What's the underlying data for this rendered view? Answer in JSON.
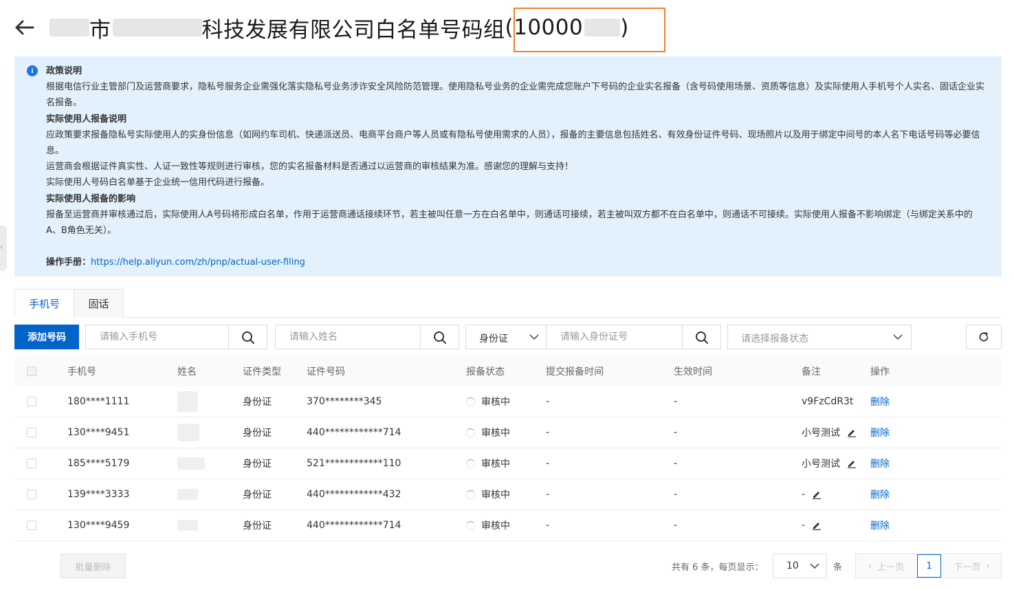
{
  "header": {
    "title_part1": "市",
    "title_part2": "科技发展有限公司白名单号码组",
    "title_paren_open": "(10000",
    "title_paren_close": ")"
  },
  "notice": {
    "heading1": "政策说明",
    "para1": "根据电信行业主管部门及运营商要求，隐私号服务企业需强化落实隐私号业务涉诈安全风险防范管理。使用隐私号业务的企业需完成您账户下号码的企业实名报备（含号码使用场景、资质等信息）及实际使用人手机号个人实名、固话企业实名报备。",
    "heading2": "实际使用人报备说明",
    "para2": "应政策要求报备隐私号实际使用人的实身份信息（如网约车司机、快递派送员、电商平台商户等人员或有隐私号使用需求的人员），报备的主要信息包括姓名、有效身份证件号码、现场照片以及用于绑定中间号的本人名下电话号码等必要信息。",
    "para3": "运营商会根据证件真实性、人证一致性等规则进行审核，您的实名报备材料是否通过以运营商的审核结果为准。感谢您的理解与支持！",
    "para4": "实际使用人号码白名单基于企业统一信用代码进行报备。",
    "heading3": "实际使用人报备的影响",
    "para5": "报备至运营商并审核通过后，实际使用人A号码将形成白名单，作用于运营商通话接续环节，若主被叫任意一方在白名单中，则通话可接续，若主被叫双方都不在白名单中，则通话不可接续。实际使用人报备不影响绑定（与绑定关系中的A、B角色无关）。",
    "manual_label": "操作手册：",
    "manual_link": "https://help.aliyun.com/zh/pnp/actual-user-filing"
  },
  "tabs": {
    "mobile": "手机号",
    "fixed": "固话"
  },
  "toolbar": {
    "add_button": "添加号码",
    "phone_placeholder": "请输入手机号",
    "name_placeholder": "请输入姓名",
    "id_type_value": "身份证",
    "id_placeholder": "请输入身份证号",
    "status_placeholder": "请选择报备状态"
  },
  "table": {
    "headers": {
      "phone": "手机号",
      "name": "姓名",
      "id_type": "证件类型",
      "id_number": "证件号码",
      "status": "报备状态",
      "submit_time": "提交报备时间",
      "effect_time": "生效时间",
      "remark": "备注",
      "action": "操作"
    },
    "rows": [
      {
        "phone": "180****1111",
        "id_type": "身份证",
        "id_number": "370********345",
        "status": "审核中",
        "submit_time": "-",
        "effect_time": "-",
        "remark": "v9FzCdR3t",
        "action": "删除"
      },
      {
        "phone": "130****9451",
        "id_type": "身份证",
        "id_number": "440************714",
        "status": "审核中",
        "submit_time": "-",
        "effect_time": "-",
        "remark": "小号测试",
        "action": "删除"
      },
      {
        "phone": "185****5179",
        "id_type": "身份证",
        "id_number": "521************110",
        "status": "审核中",
        "submit_time": "-",
        "effect_time": "-",
        "remark": "小号测试",
        "action": "删除"
      },
      {
        "phone": "139****3333",
        "id_type": "身份证",
        "id_number": "440************432",
        "status": "审核中",
        "submit_time": "-",
        "effect_time": "-",
        "remark": "-",
        "action": "删除"
      },
      {
        "phone": "130****9459",
        "id_type": "身份证",
        "id_number": "440************714",
        "status": "审核中",
        "submit_time": "-",
        "effect_time": "-",
        "remark": "-",
        "action": "删除"
      }
    ]
  },
  "footer": {
    "batch_delete": "批量删除",
    "total_text": "共有 6 条，每页显示：",
    "page_size": "10",
    "unit": "条",
    "prev": "上一页",
    "current_page": "1",
    "next": "下一页"
  },
  "colors": {
    "primary": "#0064c8",
    "notice_bg": "#e3f1fc",
    "highlight": "#f0802c"
  },
  "icons": {
    "back": "arrow-left-icon",
    "info": "info-icon",
    "search": "search-icon",
    "chevron": "chevron-down-icon",
    "refresh": "refresh-icon",
    "edit": "edit-icon",
    "spinner": "loading-icon"
  }
}
